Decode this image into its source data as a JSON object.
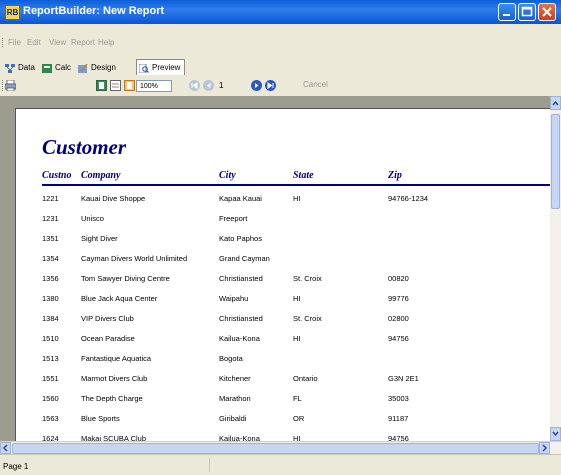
{
  "window": {
    "app_icon": "RB",
    "title": "ReportBuilder: New Report",
    "minimize_icon": "minimize-icon",
    "maximize_icon": "maximize-icon",
    "close_icon": "close-icon"
  },
  "menu": [
    "File",
    "Edit",
    "View",
    "Report",
    "Help"
  ],
  "tabs": [
    {
      "label": "Data",
      "icon": "data-icon"
    },
    {
      "label": "Calc",
      "icon": "calc-icon"
    },
    {
      "label": "Design",
      "icon": "design-icon"
    },
    {
      "label": "Preview",
      "icon": "preview-icon",
      "active": true
    }
  ],
  "toolbar": {
    "zoom": "100%",
    "page": "1",
    "cancel_label": "Cancel"
  },
  "report": {
    "title": "Customer",
    "columns": [
      "Custno",
      "Company",
      "City",
      "State",
      "Zip"
    ],
    "rows": [
      [
        "1221",
        "Kauai Dive Shoppe",
        "Kapaa Kauai",
        "HI",
        "94766-1234"
      ],
      [
        "1231",
        "Unisco",
        "Freeport",
        "",
        ""
      ],
      [
        "1351",
        "Sight Diver",
        "Kato Paphos",
        "",
        ""
      ],
      [
        "1354",
        "Cayman Divers World Unlimited",
        "Grand Cayman",
        "",
        ""
      ],
      [
        "1356",
        "Tom Sawyer Diving Centre",
        "Christiansted",
        "St. Croix",
        "00820"
      ],
      [
        "1380",
        "Blue Jack Aqua Center",
        "Waipahu",
        "HI",
        "99776"
      ],
      [
        "1384",
        "VIP Divers Club",
        "Christiansted",
        "St. Croix",
        "02800"
      ],
      [
        "1510",
        "Ocean Paradise",
        "Kailua-Kona",
        "HI",
        "94756"
      ],
      [
        "1513",
        "Fantastique Aquatica",
        "Bogota",
        "",
        ""
      ],
      [
        "1551",
        "Marmot Divers Club",
        "Kitchener",
        "Ontario",
        "G3N 2E1"
      ],
      [
        "1560",
        "The Depth Charge",
        "Marathon",
        "FL",
        "35003"
      ],
      [
        "1563",
        "Blue Sports",
        "Giribaldi",
        "OR",
        "91187"
      ],
      [
        "1624",
        "Makai SCUBA Club",
        "Kailua-Kona",
        "HI",
        "94756"
      ]
    ]
  },
  "status": {
    "page_text": "Page 1"
  },
  "colors": {
    "title_bar": "#0a5ed6",
    "report_heading": "#000080"
  }
}
